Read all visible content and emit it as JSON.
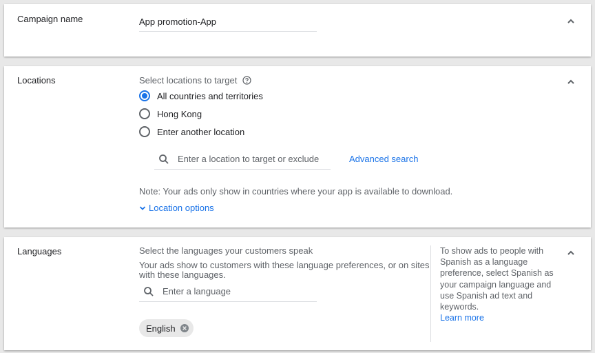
{
  "campaign_name": {
    "title": "Campaign name",
    "value": "App promotion-App"
  },
  "locations": {
    "title": "Locations",
    "prompt": "Select locations to target",
    "options": [
      {
        "label": "All countries and territories",
        "selected": true
      },
      {
        "label": "Hong Kong",
        "selected": false
      },
      {
        "label": "Enter another location",
        "selected": false
      }
    ],
    "search_placeholder": "Enter a location to target or exclude",
    "advanced_search": "Advanced search",
    "note": "Note: Your ads only show in countries where your app is available to download.",
    "location_options": "Location options"
  },
  "languages": {
    "title": "Languages",
    "prompt": "Select the languages your customers speak",
    "description": "Your ads show to customers with these language preferences, or on sites with these languages.",
    "search_placeholder": "Enter a language",
    "selected_chip": "English",
    "tip": "To show ads to people with Spanish as a language preference, select Spanish as your campaign language and use Spanish ad text and keywords.",
    "learn_more": "Learn more"
  },
  "colors": {
    "accent": "#1a73e8",
    "text_primary": "#202124",
    "text_secondary": "#5f6368",
    "divider": "#dadce0",
    "background": "#e8e8e8"
  },
  "icons": {
    "collapse": "chevron-up-icon",
    "help": "help-icon",
    "search": "search-icon",
    "expand": "chevron-down-icon",
    "chip_remove": "close-circle-icon"
  }
}
